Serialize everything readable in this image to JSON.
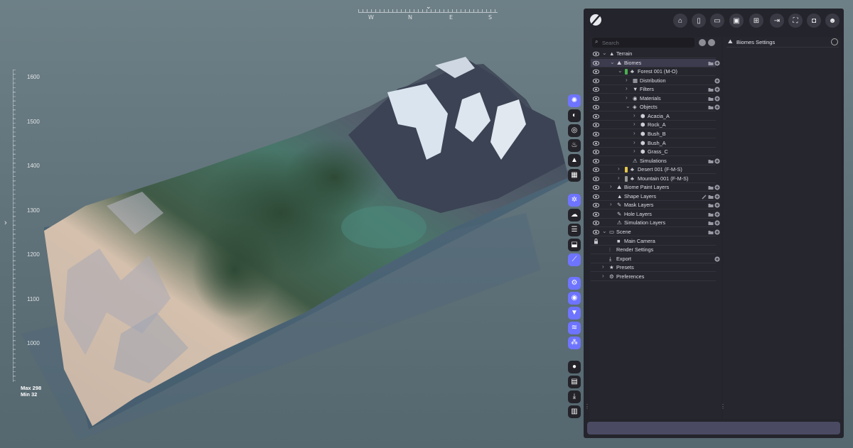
{
  "compass": {
    "caret": "⌄",
    "dirs": [
      {
        "label": "W",
        "key": "w"
      },
      {
        "label": "N",
        "key": "n"
      },
      {
        "label": "E",
        "key": "e"
      },
      {
        "label": "S",
        "key": "s"
      }
    ]
  },
  "elevation": {
    "labels": [
      "1600",
      "1500",
      "1400",
      "1300",
      "1200",
      "1100",
      "1000"
    ],
    "max_label": "Max 298",
    "min_label": "Min  32"
  },
  "viewport": {
    "left_caret": "›"
  },
  "toolbar_icons": [
    "sculpt-icon",
    "layers-icon",
    "texture-icon",
    "erosion-icon",
    "terrain-icon",
    "grid-icon",
    "biome-icon",
    "cloud-icon",
    "stack-icon",
    "stamp-icon",
    "wand-icon",
    "settings-gears-icon",
    "visibility-icon",
    "filter-icon",
    "layers-stack-icon",
    "cluster-icon",
    "disc-icon",
    "folder-image-icon",
    "download-icon",
    "stats-icon"
  ],
  "topbar_buttons": [
    {
      "name": "home-icon"
    },
    {
      "name": "new-file-icon"
    },
    {
      "name": "open-folder-icon"
    },
    {
      "name": "save-icon"
    },
    {
      "name": "save-as-icon"
    },
    {
      "name": "export-icon"
    },
    {
      "name": "fullscreen-icon"
    },
    {
      "name": "camera-icon"
    },
    {
      "name": "users-icon"
    }
  ],
  "search": {
    "placeholder": "Search"
  },
  "tree": [
    {
      "label": "Terrain",
      "depth": 0,
      "chev": "v",
      "icon": "▲",
      "eye": true,
      "actions": []
    },
    {
      "label": "Biomes",
      "depth": 1,
      "chev": "v",
      "icon": "⛰",
      "eye": true,
      "actions": [
        "folder",
        "add"
      ],
      "selected": true
    },
    {
      "label": "Forest 001 (M-O)",
      "depth": 2,
      "chev": "v",
      "icon": "♣",
      "eye": true,
      "swatch": "#4caf50",
      "actions": []
    },
    {
      "label": "Distribution",
      "depth": 3,
      "chev": ">",
      "icon": "▦",
      "eye": true,
      "actions": [
        "add"
      ]
    },
    {
      "label": "Filters",
      "depth": 3,
      "chev": ">",
      "icon": "▼",
      "eye": true,
      "actions": [
        "folder",
        "add"
      ]
    },
    {
      "label": "Materials",
      "depth": 3,
      "chev": ">",
      "icon": "◉",
      "eye": true,
      "actions": [
        "folder",
        "add"
      ]
    },
    {
      "label": "Objects",
      "depth": 3,
      "chev": "v",
      "icon": "◈",
      "eye": true,
      "actions": [
        "folder",
        "add"
      ]
    },
    {
      "label": "Acacia_A",
      "depth": 4,
      "chev": ">",
      "icon": "⬢",
      "eye": true,
      "actions": []
    },
    {
      "label": "Rock_A",
      "depth": 4,
      "chev": ">",
      "icon": "⬢",
      "eye": true,
      "actions": []
    },
    {
      "label": "Bush_B",
      "depth": 4,
      "chev": ">",
      "icon": "⬢",
      "eye": true,
      "actions": []
    },
    {
      "label": "Bush_A",
      "depth": 4,
      "chev": ">",
      "icon": "⬢",
      "eye": true,
      "actions": []
    },
    {
      "label": "Grass_C",
      "depth": 4,
      "chev": ">",
      "icon": "⬢",
      "eye": true,
      "actions": []
    },
    {
      "label": "Simulations",
      "depth": 3,
      "chev": "",
      "icon": "⚠",
      "eye": true,
      "actions": [
        "folder",
        "add"
      ]
    },
    {
      "label": "Desert 001 (F-M-S)",
      "depth": 2,
      "chev": ">",
      "icon": "♣",
      "eye": true,
      "swatch": "#e6c84a",
      "actions": []
    },
    {
      "label": "Mountain 001 (F-M-S)",
      "depth": 2,
      "chev": ">",
      "icon": "♣",
      "eye": true,
      "swatch": "#9a9a9a",
      "actions": []
    },
    {
      "label": "Biome Paint Layers",
      "depth": 1,
      "chev": ">",
      "icon": "⛰",
      "eye": true,
      "actions": [
        "folder",
        "add"
      ]
    },
    {
      "label": "Shape Layers",
      "depth": 1,
      "chev": "",
      "icon": "▲",
      "eye": true,
      "actions": [
        "brush",
        "folder",
        "add"
      ]
    },
    {
      "label": "Mask Layers",
      "depth": 1,
      "chev": ">",
      "icon": "✎",
      "eye": true,
      "actions": [
        "folder",
        "add"
      ]
    },
    {
      "label": "Hole Layers",
      "depth": 1,
      "chev": "",
      "icon": "✎",
      "eye": true,
      "actions": [
        "folder",
        "add"
      ]
    },
    {
      "label": "Simulation Layers",
      "depth": 1,
      "chev": "",
      "icon": "⚠",
      "eye": true,
      "actions": [
        "folder",
        "add"
      ]
    },
    {
      "label": "Scene",
      "depth": 0,
      "chev": "v",
      "icon": "▭",
      "eye": true,
      "actions": [
        "folder",
        "add"
      ]
    },
    {
      "label": "Main Camera",
      "depth": 1,
      "chev": "",
      "icon": "■",
      "eye": false,
      "lock": true,
      "actions": []
    },
    {
      "label": "Render Settings",
      "depth": 0,
      "chev": "",
      "icon": "⫶",
      "eye": false,
      "actions": []
    },
    {
      "label": "Export",
      "depth": 0,
      "chev": "",
      "icon": "⤓",
      "eye": false,
      "actions": [
        "add"
      ]
    },
    {
      "label": "Presets",
      "depth": 0,
      "chev": ">",
      "icon": "★",
      "eye": false,
      "actions": []
    },
    {
      "label": "Preferences",
      "depth": 0,
      "chev": ">",
      "icon": "⚙",
      "eye": false,
      "actions": []
    }
  ],
  "settings": {
    "title": "Biomes Settings",
    "icon": "⛰"
  },
  "colors": {
    "accent": "#6e74ff",
    "panel": "#24242c",
    "selected_row": "#3c3c4e"
  }
}
